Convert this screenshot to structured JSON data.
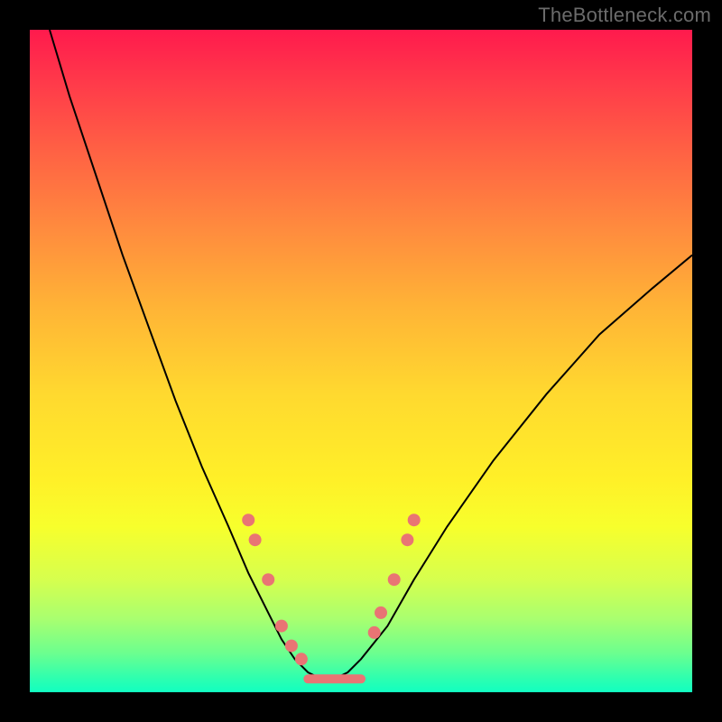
{
  "watermark": "TheBottleneck.com",
  "colors": {
    "frame": "#000000",
    "curve": "#000000",
    "marker": "#e97474",
    "gradient_stops": [
      "#ff1a4d",
      "#ff6044",
      "#ffd92f",
      "#f7ff2c",
      "#6dff8e",
      "#11ffc1"
    ]
  },
  "chart_data": {
    "type": "line",
    "title": "",
    "xlabel": "",
    "ylabel": "",
    "xlim": [
      0,
      100
    ],
    "ylim": [
      0,
      100
    ],
    "grid": false,
    "legend": false,
    "series": [
      {
        "name": "bottleneck-curve",
        "x": [
          3,
          6,
          10,
          14,
          18,
          22,
          26,
          30,
          33,
          36,
          38,
          40,
          42,
          44,
          46,
          48,
          50,
          54,
          58,
          63,
          70,
          78,
          86,
          94,
          100
        ],
        "y": [
          100,
          90,
          78,
          66,
          55,
          44,
          34,
          25,
          18,
          12,
          8,
          5,
          3,
          2,
          2,
          3,
          5,
          10,
          17,
          25,
          35,
          45,
          54,
          61,
          66
        ]
      }
    ],
    "markers": {
      "name": "highlight-dots",
      "points": [
        {
          "x": 33,
          "y": 26
        },
        {
          "x": 34,
          "y": 23
        },
        {
          "x": 36,
          "y": 17
        },
        {
          "x": 38,
          "y": 10
        },
        {
          "x": 39.5,
          "y": 7
        },
        {
          "x": 41,
          "y": 5
        },
        {
          "x": 52,
          "y": 9
        },
        {
          "x": 53,
          "y": 12
        },
        {
          "x": 55,
          "y": 17
        },
        {
          "x": 57,
          "y": 23
        },
        {
          "x": 58,
          "y": 26
        }
      ],
      "flat_segment": {
        "x0": 42,
        "x1": 50,
        "y": 2
      }
    }
  }
}
